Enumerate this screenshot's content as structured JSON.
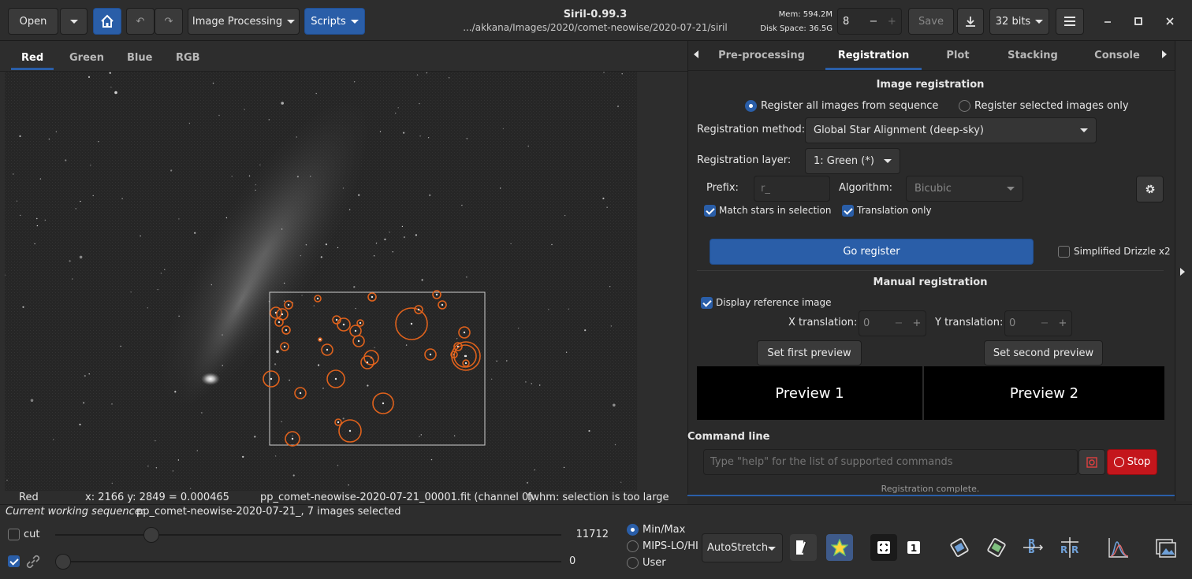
{
  "header": {
    "open_label": "Open",
    "image_processing_label": "Image Processing",
    "scripts_label": "Scripts",
    "app_title": "Siril-0.99.3",
    "path": ".../akkana/Images/2020/comet-neowise/2020-07-21/siril",
    "mem_label": "Mem: 594.2M",
    "disk_label": "Disk Space: 36.5G",
    "threads_value": "8",
    "save_label": "Save",
    "bits_label": "32 bits"
  },
  "image_tabs": [
    "Red",
    "Green",
    "Blue",
    "RGB"
  ],
  "right_tabs": [
    "Pre-processing",
    "Registration",
    "Plot",
    "Stacking",
    "Console"
  ],
  "registration": {
    "section_title": "Image registration",
    "radio_all": "Register all images from sequence",
    "radio_selected": "Register selected images only",
    "method_label": "Registration method:",
    "method_value": "Global Star Alignment (deep-sky)",
    "layer_label": "Registration layer:",
    "layer_value": "1: Green (*)",
    "prefix_label": "Prefix:",
    "prefix_placeholder": "r_",
    "algorithm_label": "Algorithm:",
    "algorithm_value": "Bicubic",
    "match_stars_label": "Match stars in selection",
    "translation_only_label": "Translation only",
    "go_register_label": "Go register",
    "drizzle_label": "Simplified Drizzle x2"
  },
  "manual": {
    "section_title": "Manual registration",
    "display_ref_label": "Display reference image",
    "x_translation_label": "X translation:",
    "x_value": "0",
    "y_translation_label": "Y translation:",
    "y_value": "0",
    "set_first_label": "Set first preview",
    "set_second_label": "Set second preview",
    "preview1_label": "Preview 1",
    "preview2_label": "Preview 2"
  },
  "command": {
    "title": "Command line",
    "placeholder": "Type \"help\" for the list of supported commands",
    "stop_label": "Stop",
    "status": "Registration complete."
  },
  "image_status": {
    "channel": "Red",
    "coords": "x: 2166 y: 2849 = 0.000465",
    "filename": "pp_comet-neowise-2020-07-21_00001.fit (channel 0)",
    "fwhm": "fwhm: selection is too large"
  },
  "sequence": {
    "label": "Current working sequence:",
    "value": "pp_comet-neowise-2020-07-21_, 7 images selected"
  },
  "bottom": {
    "cut_label": "cut",
    "high_value": "11712",
    "low_value": "0",
    "minmax_label": "Min/Max",
    "mips_label": "MIPS-LO/HI",
    "user_label": "User",
    "stretch_label": "AutoStretch",
    "high_slider_level": 0.18,
    "low_slider_level": 0.0
  },
  "colors": {
    "accent": "#2a5ea8",
    "star_circle": "#e0621c",
    "stop_red": "#c4161c"
  }
}
